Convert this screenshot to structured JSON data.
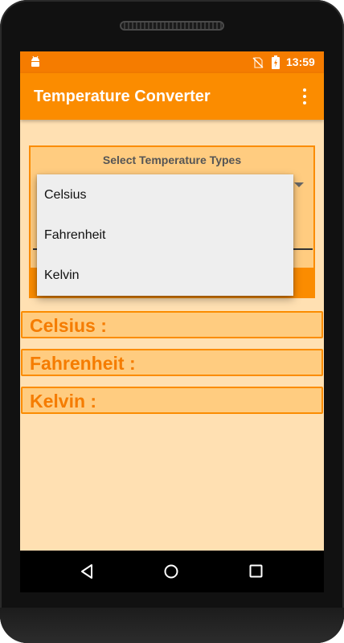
{
  "status_bar": {
    "time": "13:59",
    "icons": [
      "android-debug-icon",
      "no-sim-icon",
      "battery-charging-icon"
    ]
  },
  "app_bar": {
    "title": "Temperature Converter",
    "menu_icon": "overflow-menu-icon"
  },
  "selector": {
    "title": "Select Temperature Types",
    "dropdown_icon": "dropdown-arrow-icon"
  },
  "dropdown": {
    "options": [
      "Celsius",
      "Fahrenheit",
      "Kelvin"
    ]
  },
  "results": [
    {
      "label": "Celsius :"
    },
    {
      "label": "Fahrenheit :"
    },
    {
      "label": "Kelvin :"
    }
  ],
  "nav_bar": {
    "icons": [
      "back-icon",
      "home-icon",
      "recent-apps-icon"
    ]
  },
  "colors": {
    "status_bar": "#f57c00",
    "app_bar": "#fb8c00",
    "background": "#ffe0b2",
    "card": "#ffcc80",
    "accent_text": "#f57c00",
    "dropdown_bg": "#eeeeee"
  }
}
